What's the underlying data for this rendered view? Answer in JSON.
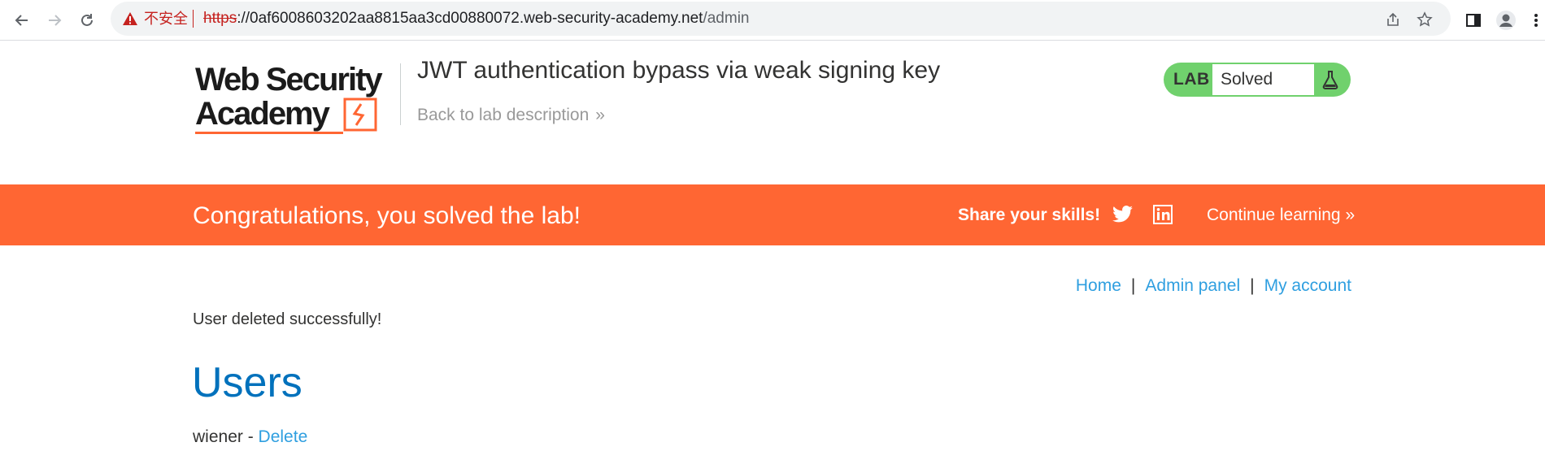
{
  "browser": {
    "insecure_label": "不安全",
    "url_scheme": "https",
    "url_host": "://0af6008603202aa8815aa3cd00880072.web-security-academy.net",
    "url_path": "/admin",
    "icons": [
      "back-icon",
      "forward-icon",
      "reload-icon",
      "warning-icon",
      "share-icon",
      "star-icon",
      "side-panel-icon",
      "profile-icon",
      "menu-icon"
    ]
  },
  "header": {
    "logo_line1": "Web Security",
    "logo_line2": "Academy",
    "lab_title": "JWT authentication bypass via weak signing key",
    "back_link": "Back to lab description",
    "lab_badge": "LAB",
    "lab_status": "Solved"
  },
  "banner": {
    "message": "Congratulations, you solved the lab!",
    "share_label": "Share your skills!",
    "continue_label": "Continue learning"
  },
  "nav": {
    "home": "Home",
    "admin_panel": "Admin panel",
    "my_account": "My account",
    "separator": "|"
  },
  "main": {
    "message": "User deleted successfully!",
    "heading": "Users",
    "users": [
      {
        "name": "wiener",
        "separator": " - ",
        "action": "Delete"
      }
    ]
  },
  "colors": {
    "brand_orange": "#ff6633",
    "lab_green": "#70d16d",
    "link_blue": "#2f9fe0",
    "heading_blue": "#0071bc",
    "insecure_red": "#c5221f"
  }
}
